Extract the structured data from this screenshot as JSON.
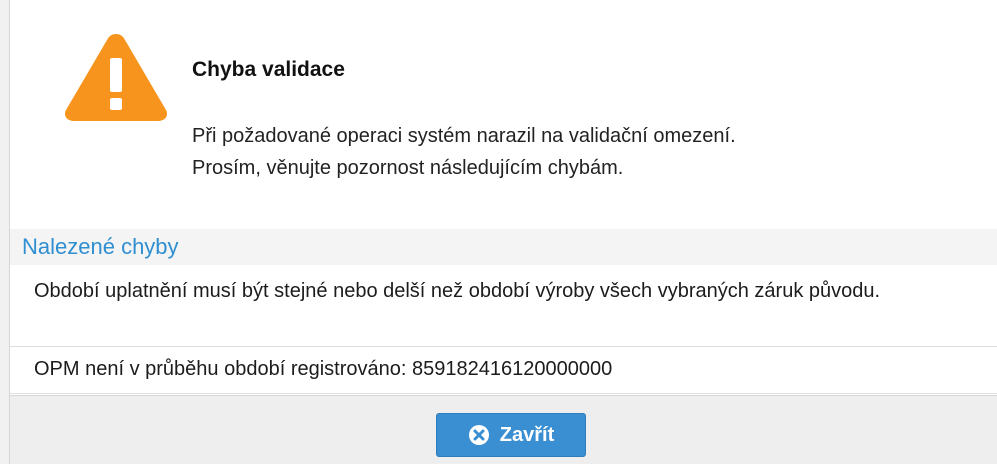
{
  "dialog": {
    "title": "Chyba validace",
    "message_lines": [
      "Při požadované operaci systém narazil na validační omezení.",
      "Prosím, věnujte pozornost následujícím chybám."
    ],
    "icon": "warning-icon",
    "colors": {
      "warning": "#f7941d",
      "heading": "#2f8fd1",
      "button": "#3a8fd3"
    }
  },
  "errors": {
    "heading": "Nalezené chyby",
    "items": [
      "Období uplatnění musí být stejné nebo delší než období výroby všech vybraných záruk původu.",
      "OPM není v průběhu období registrováno: 859182416120000000"
    ]
  },
  "footer": {
    "close_label": "Zavřít",
    "close_icon": "close-circle-icon"
  }
}
